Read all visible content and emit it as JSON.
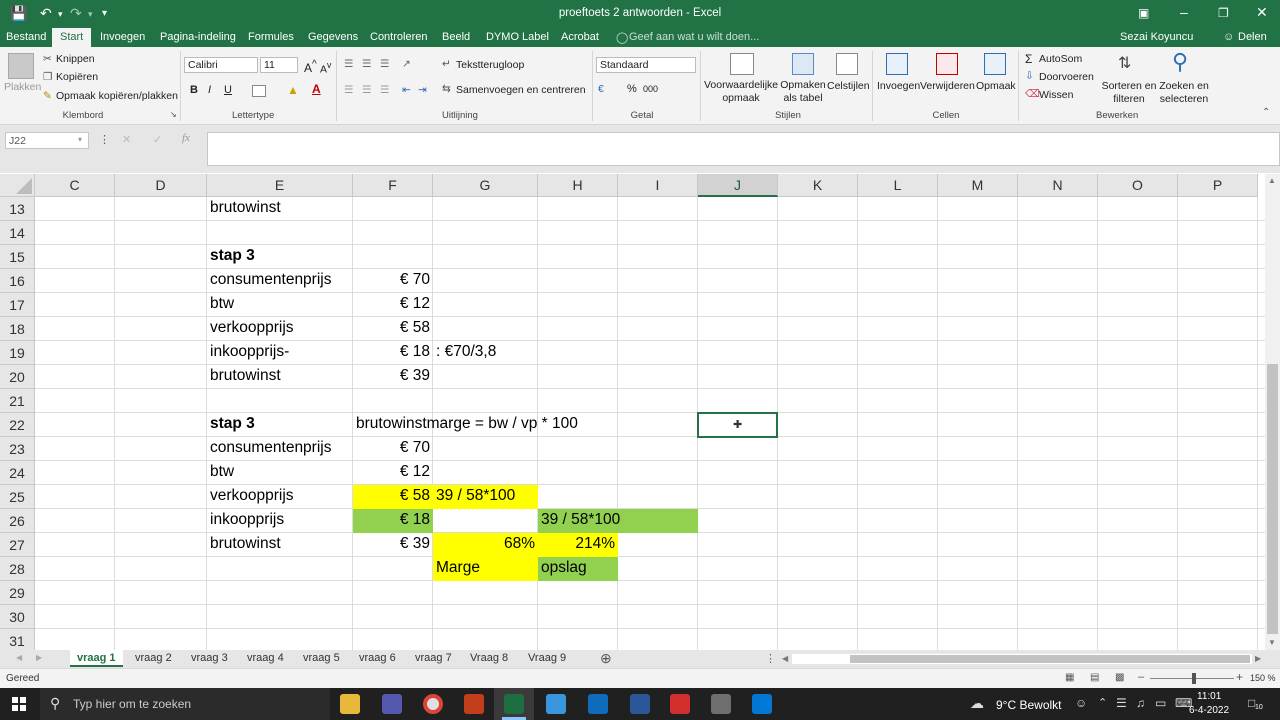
{
  "window": {
    "title": "proeftoets 2 antwoorden - Excel",
    "user": "Sezai Koyuncu",
    "share": "Delen"
  },
  "menu": {
    "items": [
      "Bestand",
      "Start",
      "Invoegen",
      "Pagina-indeling",
      "Formules",
      "Gegevens",
      "Controleren",
      "Beeld",
      "DYMO Label",
      "Acrobat"
    ],
    "search_hint": "Geef aan wat u wilt doen..."
  },
  "ribbon": {
    "clipboard": {
      "paste": "Plakken",
      "cut": "Knippen",
      "copy": "Kopiëren",
      "format_painter": "Opmaak kopiëren/plakken",
      "group": "Klembord"
    },
    "font": {
      "name": "Calibri",
      "size": "11",
      "bold": "B",
      "italic": "I",
      "underline": "U",
      "group": "Lettertype"
    },
    "alignment": {
      "wrap": "Tekstterugloop",
      "merge": "Samenvoegen en centreren",
      "group": "Uitlijning"
    },
    "number": {
      "format": "Standaard",
      "percent": "%",
      "thousands": "000",
      "group": "Getal"
    },
    "styles": {
      "conditional": "Voorwaardelijke opmaak",
      "as_table": "Opmaken als tabel",
      "cell_styles": "Celstijlen",
      "group": "Stijlen"
    },
    "cells": {
      "insert": "Invoegen",
      "delete": "Verwijderen",
      "format": "Opmaak",
      "group": "Cellen"
    },
    "editing": {
      "autosum": "AutoSom",
      "fill": "Doorvoeren",
      "clear": "Wissen",
      "sort": "Sorteren en filteren",
      "find": "Zoeken en selecteren",
      "group": "Bewerken"
    }
  },
  "formula_bar": {
    "name_box": "J22",
    "fx": "fx",
    "formula": ""
  },
  "columns": [
    "C",
    "D",
    "E",
    "F",
    "G",
    "H",
    "I",
    "J",
    "K",
    "L",
    "M",
    "N",
    "O",
    "P"
  ],
  "selected_column": "J",
  "selected_cell": "J22",
  "rows": [
    "13",
    "14",
    "15",
    "16",
    "17",
    "18",
    "19",
    "20",
    "21",
    "22",
    "23",
    "24",
    "25",
    "26",
    "27",
    "28",
    "29",
    "30",
    "31"
  ],
  "cells": {
    "E13": "brutowinst",
    "E15": "stap 3",
    "E16": "consumentenprijs",
    "F16": "€ 70",
    "E17": "btw",
    "F17": "€ 12",
    "E18": "verkoopprijs",
    "F18": "€ 58",
    "E19": "inkoopprijs-",
    "F19": "€ 18",
    "G19": ": €70/3,8",
    "E20": "brutowinst",
    "F20": "€ 39",
    "E22": "stap 3",
    "F22": "brutowinstmarge = bw / vp * 100",
    "E23": "consumentenprijs",
    "F23": "€ 70",
    "E24": "btw",
    "F24": "€ 12",
    "E25": "verkoopprijs",
    "F25": "€ 58",
    "G25": "39 / 58*100",
    "E26": "inkoopprijs",
    "F26": "€ 18",
    "H26": "39 / 58*100",
    "E27": "brutowinst",
    "F27": "€ 39",
    "G27": "68%",
    "H27": "214%",
    "G28": "Marge",
    "H28": "opslag"
  },
  "highlight_colors": {
    "yellow": "#ffff00",
    "green": "#92d050"
  },
  "sheets": [
    "vraag 1",
    "vraag 2",
    "vraag 3",
    "vraag 4",
    "vraag 5",
    "vraag 6",
    "vraag 7",
    "Vraag 8",
    "Vraag 9"
  ],
  "active_sheet": "vraag 1",
  "status": {
    "ready": "Gereed",
    "zoom": "150 %"
  },
  "taskbar": {
    "search": "Typ hier om te zoeken",
    "weather": "9°C Bewolkt",
    "time": "11:01",
    "date": "6-4-2022",
    "notifications": "10"
  }
}
